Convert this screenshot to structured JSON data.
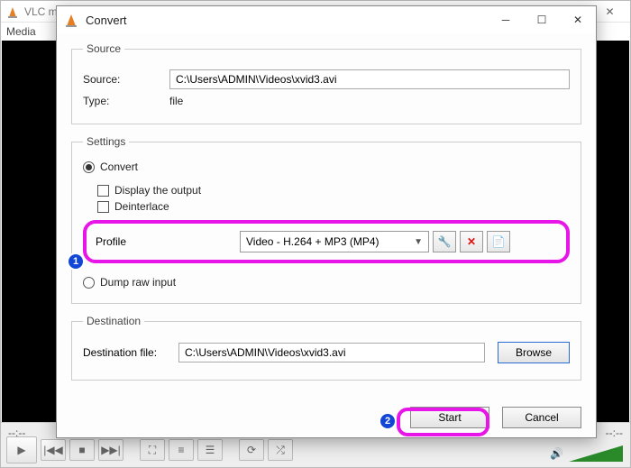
{
  "main": {
    "title": "VLC media player",
    "menu": "Media",
    "time": "--:--",
    "duration": "--:--"
  },
  "dialog": {
    "title": "Convert",
    "source": {
      "legend": "Source",
      "label": "Source:",
      "value": "C:\\Users\\ADMIN\\Videos\\xvid3.avi",
      "type_label": "Type:",
      "type_value": "file"
    },
    "settings": {
      "legend": "Settings",
      "convert": "Convert",
      "display": "Display the output",
      "deinterlace": "Deinterlace",
      "profile_label": "Profile",
      "profile_value": "Video - H.264 + MP3 (MP4)",
      "dump": "Dump raw input"
    },
    "destination": {
      "legend": "Destination",
      "label": "Destination file:",
      "value": "C:\\Users\\ADMIN\\Videos\\xvid3.avi",
      "browse": "Browse"
    },
    "buttons": {
      "start": "Start",
      "cancel": "Cancel"
    }
  },
  "annotations": {
    "step1": "1",
    "step2": "2"
  }
}
